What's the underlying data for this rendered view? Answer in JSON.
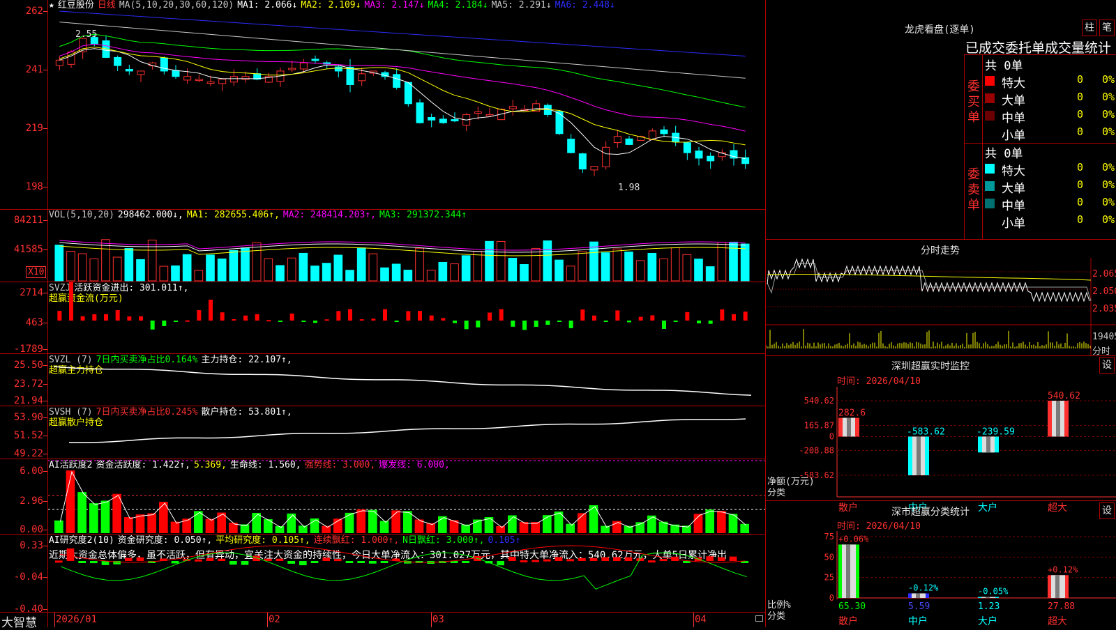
{
  "app": {
    "brand": "大智慧",
    "stock": "红豆股份",
    "period": "日线"
  },
  "main": {
    "ma_header": [
      {
        "text": "★",
        "color": "#ffffff"
      },
      {
        "text": "红豆股份",
        "color": "#ffffff"
      },
      {
        "text": "日线",
        "color": "#ff3030"
      },
      {
        "text": "MA(5,10,20,30,60,120)",
        "color": "#c8c8c8"
      },
      {
        "text": "MA1: 2.066↓",
        "color": "#ffffff"
      },
      {
        "text": "MA2: 2.109↓",
        "color": "#ffff00"
      },
      {
        "text": "MA3: 2.147↓",
        "color": "#ff00ff"
      },
      {
        "text": "MA4: 2.184↓",
        "color": "#00ff00"
      },
      {
        "text": "MA5: 2.291↓",
        "color": "#c8c8c8"
      },
      {
        "text": "MA6: 2.448↓",
        "color": "#2d2dff"
      }
    ],
    "yticks": [
      "262",
      "241",
      "219",
      "198"
    ],
    "annot_high": "2.55",
    "annot_low": "1.98"
  },
  "vol": {
    "header": [
      {
        "text": "VOL(5,10,20)",
        "color": "#c8c8c8"
      },
      {
        "text": "298462.000↓,",
        "color": "#ffffff"
      },
      {
        "text": "MA1: 282655.406↑,",
        "color": "#ffff00"
      },
      {
        "text": "MA2: 248414.203↑,",
        "color": "#ff00ff"
      },
      {
        "text": "MA3: 291372.344↑",
        "color": "#00ff00"
      }
    ],
    "yticks": [
      "84211",
      "41585"
    ],
    "unit": "X10"
  },
  "svzj": {
    "header": [
      {
        "text": "SVZJ",
        "color": "#c8c8c8"
      },
      {
        "text": "活跃资金进出: 301.011↑,",
        "color": "#ffffff"
      }
    ],
    "subtitle": "超赢资金流(万元)",
    "yticks": [
      "2714",
      "463",
      "-1789"
    ]
  },
  "svzl": {
    "header": [
      {
        "text": "SVZL (7)",
        "color": "#c8c8c8"
      },
      {
        "text": "7日内买卖净占比0.164%",
        "color": "#00ff00"
      },
      {
        "text": "主力持仓: 22.107↑,",
        "color": "#ffffff"
      }
    ],
    "subtitle": "超赢主力持仓",
    "yticks": [
      "25.50",
      "23.72",
      "21.94"
    ]
  },
  "svsh": {
    "header": [
      {
        "text": "SVSH (7)",
        "color": "#c8c8c8"
      },
      {
        "text": "7日内买卖净占比0.245%",
        "color": "#ff3030"
      },
      {
        "text": "散户持仓: 53.801↑,",
        "color": "#ffffff"
      }
    ],
    "subtitle": "超赢散户持仓",
    "yticks": [
      "53.90",
      "51.52",
      "49.22"
    ]
  },
  "ai1": {
    "header": [
      {
        "text": "AI活跃度2",
        "color": "#ffffff"
      },
      {
        "text": "资金活跃度: 1.422↑,",
        "color": "#ffffff"
      },
      {
        "text": "5.369,",
        "color": "#ffff00"
      },
      {
        "text": "生命线: 1.560,",
        "color": "#ffffff"
      },
      {
        "text": "强势线: 3.000,",
        "color": "#ff3030"
      },
      {
        "text": "爆发线: 6.000,",
        "color": "#ff00ff"
      }
    ],
    "yticks": [
      "6.00",
      "2.96",
      "0.00"
    ]
  },
  "ai2": {
    "header": [
      {
        "text": "AI研究度2(10)",
        "color": "#ffffff"
      },
      {
        "text": "资金研究度: 0.050↑,",
        "color": "#ffffff"
      },
      {
        "text": "平均研究度: 0.105↑,",
        "color": "#ffff00"
      },
      {
        "text": "连续飘红: 1.000↑,",
        "color": "#ff3030"
      },
      {
        "text": "N日飘红: 3.000↑,",
        "color": "#00ff00"
      },
      {
        "text": "0.105↑",
        "color": "#2d2dff"
      }
    ],
    "comment": "近期大资金总体偏多，虽不活跃，但有异动，宜关注大资金的持续性，今日大单净流入：301.027万元，其中特大单净流入：540.62万元，大单5日累计净出",
    "yticks": [
      "0.33",
      "-0.04",
      "-0.40"
    ]
  },
  "xaxis": [
    "2026/01",
    "02",
    "03",
    "04"
  ],
  "longhu": {
    "title": "龙虎看盘(逐单)",
    "btn1": "柱",
    "btn2": "笔",
    "subtitle": "已成交委托单成交量统计",
    "buy": {
      "label": [
        "委",
        "买",
        "单"
      ],
      "total": "共 0单",
      "rows": [
        {
          "name": "特大",
          "val": "0",
          "pct": "0%",
          "color": "#ff0000"
        },
        {
          "name": "大单",
          "val": "0",
          "pct": "0%",
          "color": "#9a0000"
        },
        {
          "name": "中单",
          "val": "0",
          "pct": "0%",
          "color": "#6a0000"
        },
        {
          "name": "小单",
          "val": "0",
          "pct": "0%",
          "color": ""
        }
      ]
    },
    "sell": {
      "label": [
        "委",
        "卖",
        "单"
      ],
      "total": "共 0单",
      "rows": [
        {
          "name": "特大",
          "val": "0",
          "pct": "0%",
          "color": "#00ffff"
        },
        {
          "name": "大单",
          "val": "0",
          "pct": "0%",
          "color": "#009a9a"
        },
        {
          "name": "中单",
          "val": "0",
          "pct": "0%",
          "color": "#007070"
        },
        {
          "name": "小单",
          "val": "0",
          "pct": "0%",
          "color": ""
        }
      ]
    }
  },
  "fenshi": {
    "title": "分时走势",
    "yticks": [
      "2.065",
      "2.050",
      "2.035"
    ],
    "vol_label": "19405",
    "vol_unit": "分时"
  },
  "monitor": {
    "title": "深圳超赢实时监控",
    "btn": "设",
    "time_label": "时间: 2026/04/10",
    "yticks": [
      "540.62",
      "165.87",
      "0",
      "-208.88",
      "-583.62"
    ],
    "ylabel1": "净额(万元)",
    "ylabel2": "分类",
    "categories": [
      "散户",
      "中户",
      "大户",
      "超大"
    ],
    "values": [
      282.6,
      -583.62,
      -239.59,
      540.62
    ],
    "value_labels": [
      "282.6",
      "-583.62",
      "-239.59",
      "540.62"
    ]
  },
  "classify": {
    "title": "深市超赢分类统计",
    "btn": "设",
    "time_label": "时间: 2026/04/10",
    "yticks": [
      "75",
      "50",
      "25",
      "0"
    ],
    "ylabel1": "比例%",
    "ylabel2": "分类",
    "categories": [
      "散户",
      "中户",
      "大户",
      "超大"
    ],
    "values": [
      65.3,
      5.59,
      1.23,
      27.88
    ],
    "value_labels": [
      "65.30",
      "5.59",
      "1.23",
      "27.88"
    ],
    "changes": [
      "+0.06%",
      "-0.12%",
      "-0.05%",
      "+0.12%"
    ]
  }
}
